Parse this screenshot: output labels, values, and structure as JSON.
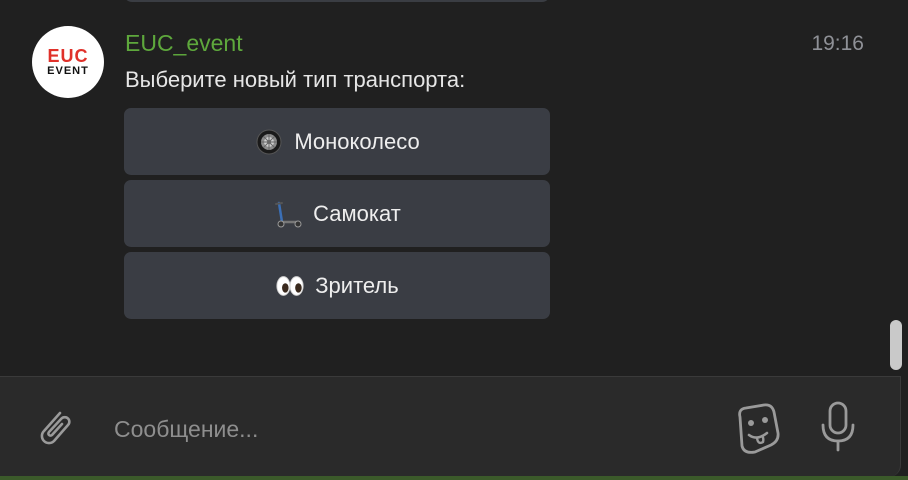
{
  "message": {
    "sender": "EUC_event",
    "time": "19:16",
    "text": "Выберите новый тип транспорта:",
    "avatar": {
      "line1": "EUC",
      "line2": "EVENT"
    }
  },
  "keyboard": {
    "buttons": [
      {
        "label": "Моноколесо",
        "icon": "wheel-icon"
      },
      {
        "label": "Самокат",
        "icon": "scooter-icon"
      },
      {
        "label": "Зритель",
        "icon": "eyes-icon"
      }
    ]
  },
  "composer": {
    "placeholder": "Сообщение...",
    "attach_icon": "paperclip-icon",
    "sticker_icon": "sticker-icon",
    "mic_icon": "microphone-icon"
  },
  "colors": {
    "background": "#202020",
    "sender": "#5ea83c",
    "button": "#3a3d44",
    "avatar_accent": "#e0312a"
  }
}
